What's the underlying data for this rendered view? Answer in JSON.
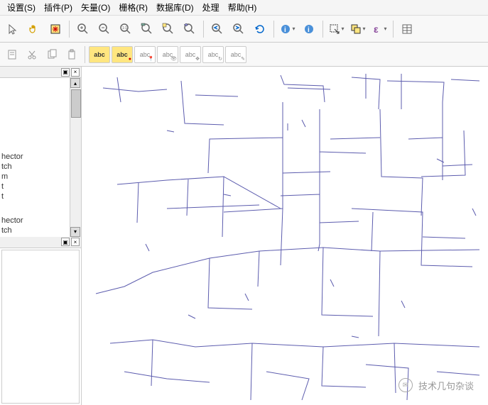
{
  "menu": {
    "settings": "设置(S)",
    "plugins": "插件(P)",
    "vector": "矢量(O)",
    "raster": "栅格(R)",
    "database": "数据库(D)",
    "processing": "处理",
    "help": "帮助(H)"
  },
  "toolbar": {
    "abc_label": "abc"
  },
  "layers": {
    "items": [
      "hector",
      "tch",
      "m",
      "t",
      "t",
      "hector",
      "tch"
    ]
  },
  "watermark": {
    "text": "技术几句杂谈"
  },
  "icons": {
    "pointer": "↖",
    "hand": "✋",
    "pan": "✥",
    "zoom_in": "+",
    "zoom_out": "−",
    "zoom_full": "1:1",
    "zoom_sel": "⊡",
    "zoom_layer": "▦",
    "zoom_last": "←",
    "zoom_next": "→",
    "refresh": "↻",
    "info": "ⓘ",
    "info2": "ⓘ",
    "select": "▭",
    "select_all": "▦",
    "epsilon": "ε",
    "measure": "📏",
    "table": "▤",
    "cut": "✂",
    "copy": "⎘",
    "paste": "📋"
  }
}
